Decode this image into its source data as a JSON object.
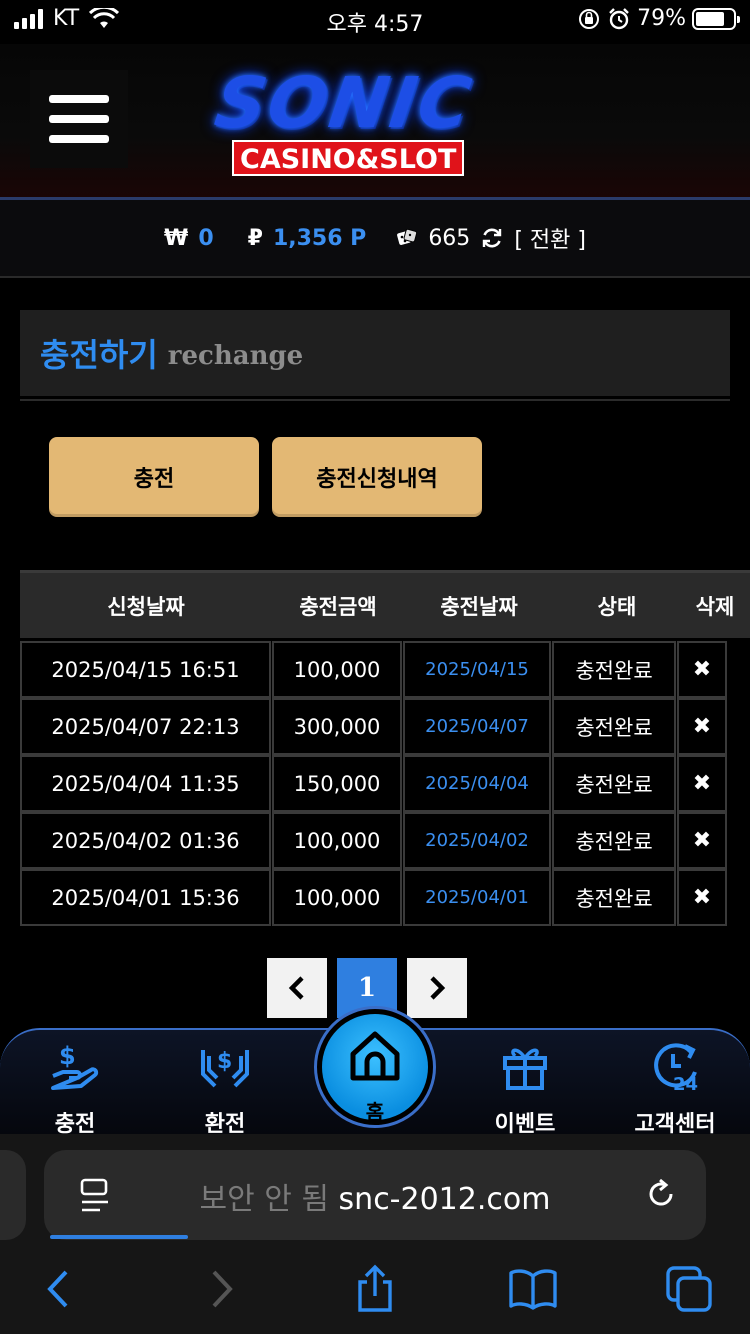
{
  "status_bar": {
    "carrier": "KT",
    "time": "오후 4:57",
    "battery": "79%",
    "battery_level": 0.79
  },
  "header": {
    "logo_main": "SONIC",
    "logo_sub": "CASINO&SLOT"
  },
  "balance": {
    "won_symbol": "₩",
    "won_value": "0",
    "point_symbol": "₽",
    "point_value": "1,356 P",
    "chip_value": "665",
    "switch_label": "[ 전환 ]"
  },
  "section": {
    "title_ko": "충전하기",
    "title_en": "rechange"
  },
  "buttons": {
    "recharge": "충전",
    "history": "충전신청내역"
  },
  "table": {
    "headers": [
      "신청날짜",
      "충전금액",
      "충전날짜",
      "상태",
      "삭제"
    ],
    "rows": [
      {
        "requested": "2025/04/15 16:51",
        "amount": "100,000",
        "charged": "2025/04/15",
        "status": "충전완료",
        "delete": "✖"
      },
      {
        "requested": "2025/04/07 22:13",
        "amount": "300,000",
        "charged": "2025/04/07",
        "status": "충전완료",
        "delete": "✖"
      },
      {
        "requested": "2025/04/04 11:35",
        "amount": "150,000",
        "charged": "2025/04/04",
        "status": "충전완료",
        "delete": "✖"
      },
      {
        "requested": "2025/04/02 01:36",
        "amount": "100,000",
        "charged": "2025/04/02",
        "status": "충전완료",
        "delete": "✖"
      },
      {
        "requested": "2025/04/01 15:36",
        "amount": "100,000",
        "charged": "2025/04/01",
        "status": "충전완료",
        "delete": "✖"
      }
    ]
  },
  "pagination": {
    "prev": "‹",
    "current": "1",
    "next": "›"
  },
  "bottom_nav": {
    "recharge": "충전",
    "exchange": "환전",
    "home": "홈",
    "event": "이벤트",
    "support": "고객센터"
  },
  "browser": {
    "insecure_label": "보안 안 됨",
    "domain": "snc-2012.com"
  },
  "colors": {
    "accent_blue": "#2f8cf0",
    "button_gold": "#e3b874",
    "logo_red": "#e0131a"
  }
}
